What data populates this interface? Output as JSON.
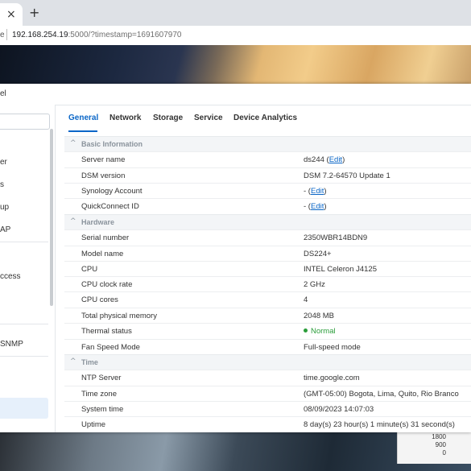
{
  "browser": {
    "tab_close": "×",
    "new_tab": "+",
    "address_prefix": "e",
    "url_host": "192.168.254.19",
    "url_rest": ":5000/?timestamp=1691607970"
  },
  "window": {
    "title": "el"
  },
  "sidebar": {
    "items": [
      {
        "label": "er"
      },
      {
        "label": "s"
      },
      {
        "label": "up"
      },
      {
        "label": "AP"
      },
      {
        "label": "ccess"
      },
      {
        "label": "SNMP"
      }
    ]
  },
  "tabs": [
    "General",
    "Network",
    "Storage",
    "Service",
    "Device Analytics"
  ],
  "sections": {
    "basic": "Basic Information",
    "hardware": "Hardware",
    "time": "Time"
  },
  "basic_info": [
    {
      "label": "Server name",
      "value": "ds244",
      "link": "Edit"
    },
    {
      "label": "DSM version",
      "value": "DSM 7.2-64570 Update 1"
    },
    {
      "label": "Synology Account",
      "value": "-",
      "link": "Edit"
    },
    {
      "label": "QuickConnect ID",
      "value": "-",
      "link": "Edit"
    }
  ],
  "hardware": [
    {
      "label": "Serial number",
      "value": "2350WBR14BDN9"
    },
    {
      "label": "Model name",
      "value": "DS224+"
    },
    {
      "label": "CPU",
      "value": "INTEL Celeron J4125"
    },
    {
      "label": "CPU clock rate",
      "value": "2 GHz"
    },
    {
      "label": "CPU cores",
      "value": "4"
    },
    {
      "label": "Total physical memory",
      "value": "2048 MB"
    },
    {
      "label": "Thermal status",
      "value": "Normal",
      "status": "ok"
    },
    {
      "label": "Fan Speed Mode",
      "value": "Full-speed mode"
    }
  ],
  "time": [
    {
      "label": "NTP Server",
      "value": "time.google.com"
    },
    {
      "label": "Time zone",
      "value": "(GMT-05:00) Bogota, Lima, Quito, Rio Branco"
    },
    {
      "label": "System time",
      "value": "08/09/2023 14:07:03"
    },
    {
      "label": "Uptime",
      "value": "8 day(s) 23 hour(s) 1 minute(s) 31 second(s)"
    }
  ],
  "background_widget": {
    "values": [
      "1800",
      "900",
      "0"
    ]
  },
  "colors": {
    "accent": "#0a66c7",
    "status_ok": "#2a9d3a"
  }
}
